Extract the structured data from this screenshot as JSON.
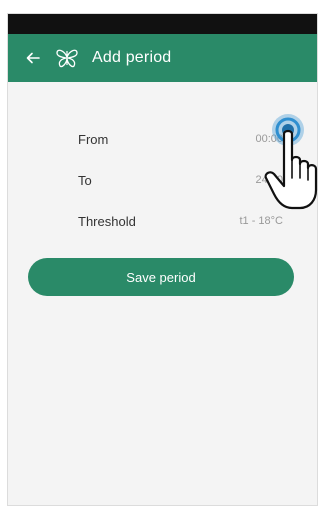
{
  "header": {
    "title": "Add period",
    "back_icon": "arrow-left-icon",
    "logo_icon": "butterfly-logo-icon"
  },
  "form": {
    "rows": [
      {
        "label": "From",
        "value": "00:00"
      },
      {
        "label": "To",
        "value": "24:00"
      },
      {
        "label": "Threshold",
        "value": "t1 - 18°C"
      }
    ]
  },
  "actions": {
    "save_label": "Save period"
  },
  "colors": {
    "primary": "#2a8a68",
    "status_bar": "#111111",
    "background": "#f4f4f4",
    "touch_indicator": "#2f8fd0"
  }
}
